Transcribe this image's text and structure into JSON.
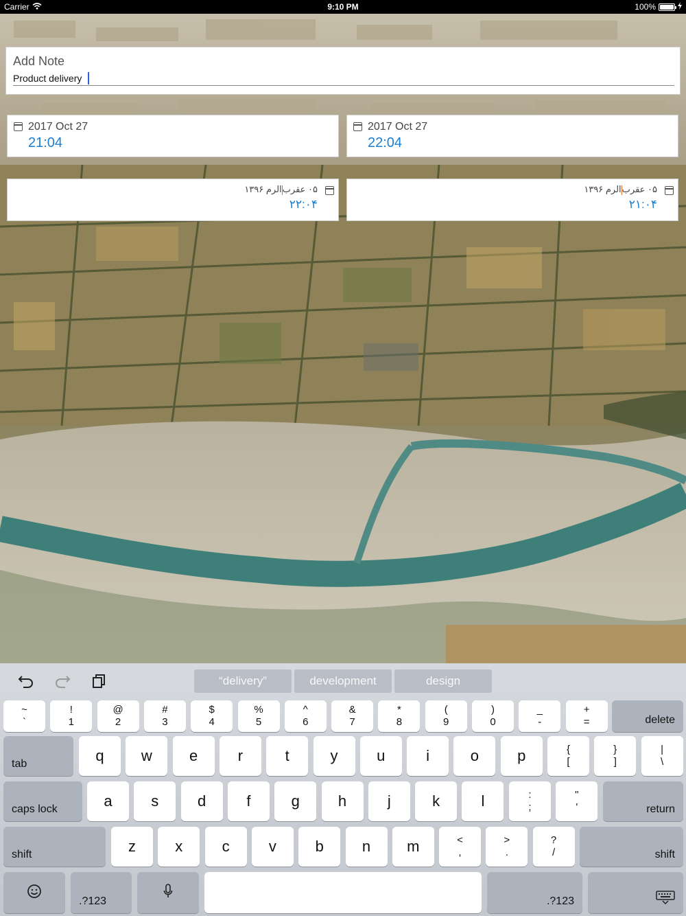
{
  "status_bar": {
    "carrier": "Carrier",
    "time": "9:10 PM",
    "battery": "100%",
    "battery_level": 1.0
  },
  "note": {
    "label": "Add Note",
    "value": "Product delivery"
  },
  "dates": {
    "start": {
      "date": "2017 Oct 27",
      "time": "21:04"
    },
    "end": {
      "date": "2017 Oct 27",
      "time": "22:04"
    },
    "persian_end": {
      "date": "۰۵ عقرب",
      "date_suffix": "الرم ۱۳۹۶",
      "time": "۲۲:۰۴"
    },
    "persian_start": {
      "date": "۰۵ عقرب",
      "date_suffix": "الرم ۱۳۹۶",
      "time": "۲۱:۰۴"
    }
  },
  "keyboard": {
    "toolbar": {
      "undo_icon": "undo-arrow-icon",
      "redo_icon": "redo-arrow-icon",
      "paste_icon": "clipboard-icon"
    },
    "suggestions": [
      "“delivery”",
      "development",
      "design"
    ],
    "number_row": [
      {
        "top": "~",
        "bottom": "`"
      },
      {
        "top": "!",
        "bottom": "1"
      },
      {
        "top": "@",
        "bottom": "2"
      },
      {
        "top": "#",
        "bottom": "3"
      },
      {
        "top": "$",
        "bottom": "4"
      },
      {
        "top": "%",
        "bottom": "5"
      },
      {
        "top": "^",
        "bottom": "6"
      },
      {
        "top": "&",
        "bottom": "7"
      },
      {
        "top": "*",
        "bottom": "8"
      },
      {
        "top": "(",
        "bottom": "9"
      },
      {
        "top": ")",
        "bottom": "0"
      },
      {
        "top": "_",
        "bottom": "-"
      },
      {
        "top": "+",
        "bottom": "="
      }
    ],
    "delete_label": "delete",
    "tab_label": "tab",
    "top_letters": [
      "q",
      "w",
      "e",
      "r",
      "t",
      "y",
      "u",
      "i",
      "o",
      "p"
    ],
    "top_symbols": [
      {
        "top": "{",
        "bottom": "["
      },
      {
        "top": "}",
        "bottom": "]"
      },
      {
        "top": "|",
        "bottom": "\\"
      }
    ],
    "caps_label": "caps lock",
    "home_letters": [
      "a",
      "s",
      "d",
      "f",
      "g",
      "h",
      "j",
      "k",
      "l"
    ],
    "home_symbols": [
      {
        "top": ":",
        "bottom": ";"
      },
      {
        "top": "\"",
        "bottom": "'"
      }
    ],
    "return_label": "return",
    "shift_label": "shift",
    "bottom_letters": [
      "z",
      "x",
      "c",
      "v",
      "b",
      "n",
      "m"
    ],
    "bottom_symbols": [
      {
        "top": "<",
        "bottom": ","
      },
      {
        "top": ">",
        "bottom": "."
      },
      {
        "top": "?",
        "bottom": "/"
      }
    ],
    "numbers_label": ".?123",
    "emoji_icon": "emoji-icon",
    "mic_icon": "microphone-icon",
    "hide_icon": "keyboard-hide-icon"
  }
}
